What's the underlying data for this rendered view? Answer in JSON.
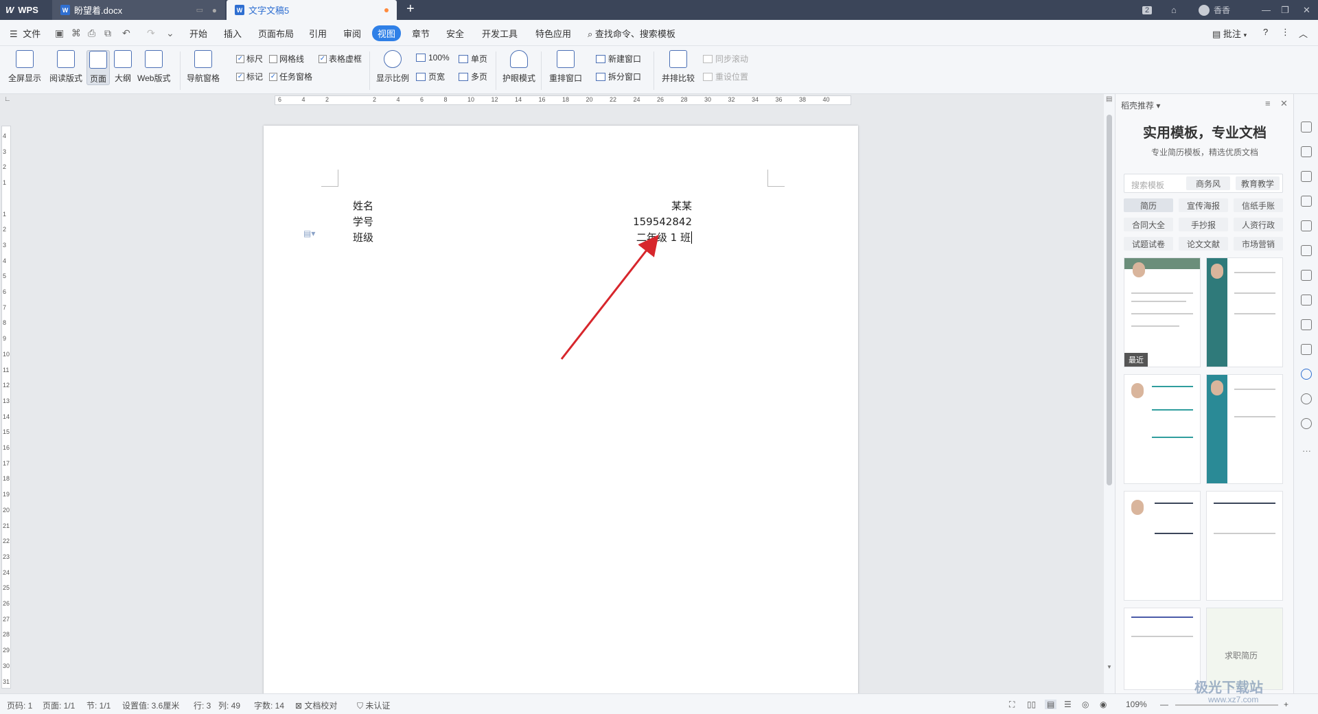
{
  "titlebar": {
    "app_tab": "WPS",
    "doc_tab1": "盼望着.docx",
    "doc_tab2": "文字文稿5",
    "page_count_badge": "2",
    "user": "香香",
    "new_tab": "+",
    "close": "✕",
    "minimize": "—",
    "restore": "❐"
  },
  "menubar": {
    "file": "文件",
    "items": [
      "开始",
      "插入",
      "页面布局",
      "引用",
      "审阅",
      "视图",
      "章节",
      "安全",
      "开发工具",
      "特色应用"
    ],
    "active_item": "视图",
    "search": "查找命令、搜索模板",
    "comment": "批注",
    "help": "?"
  },
  "ribbon": {
    "fullscreen": "全屏显示",
    "reading": "阅读版式",
    "page": "页面",
    "outline": "大纲",
    "web": "Web版式",
    "nav_pane": "导航窗格",
    "ruler": "标尺",
    "gridlines": "网格线",
    "table_gridlines": "表格虚框",
    "marks": "标记",
    "task_pane": "任务窗格",
    "zoom_ratio": "显示比例",
    "zoom_100": "100%",
    "page_width": "页宽",
    "single_page": "单页",
    "multi_page": "多页",
    "eye_mode": "护眼模式",
    "rearrange": "重排窗口",
    "new_window": "新建窗口",
    "split_window": "拆分窗口",
    "side_by_side": "并排比较",
    "sync_scroll": "同步滚动",
    "reset_pos": "重设位置"
  },
  "ruler": {
    "h_ticks": [
      "6",
      "4",
      "2",
      "",
      "2",
      "4",
      "6",
      "8",
      "10",
      "12",
      "14",
      "16",
      "18",
      "20",
      "22",
      "24",
      "26",
      "28",
      "30",
      "32",
      "34",
      "36",
      "38",
      "40"
    ],
    "v_ticks": [
      "4",
      "3",
      "2",
      "1",
      "",
      "1",
      "2",
      "3",
      "4",
      "5",
      "6",
      "7",
      "8",
      "9",
      "10",
      "11",
      "12",
      "13",
      "14",
      "15",
      "16",
      "17",
      "18",
      "19",
      "20",
      "21",
      "22",
      "23",
      "24",
      "25",
      "26",
      "27",
      "28",
      "29",
      "30",
      "31"
    ]
  },
  "document": {
    "left_lines": [
      "姓名",
      "学号",
      "班级"
    ],
    "right_lines": [
      "某某",
      "159542842",
      "二年级 1 班"
    ]
  },
  "panel": {
    "title": "稻壳推荐",
    "headline": "实用模板，专业文档",
    "subline": "专业简历模板，精选优质文档",
    "search_placeholder": "搜索模板",
    "tags": [
      "商务风",
      "教育教学"
    ],
    "categories": [
      "简历",
      "宣传海报",
      "信纸手账",
      "合同大全",
      "手抄报",
      "人资行政",
      "试题试卷",
      "论文文献",
      "市场营销"
    ],
    "recent_badge": "最近",
    "card_caption": "求职简历"
  },
  "status": {
    "page_num": "页码: 1",
    "pages": "页面: 1/1",
    "section": "节: 1/1",
    "setting": "设置值: 3.6厘米",
    "line": "行: 3",
    "col": "列: 49",
    "words": "字数: 14",
    "proof": "文档校对",
    "cert": "未认证",
    "zoom": "109%",
    "zoom_minus": "—",
    "zoom_plus": "+"
  },
  "watermark": {
    "text": "极光下载站",
    "sub": "www.xz7.com"
  }
}
